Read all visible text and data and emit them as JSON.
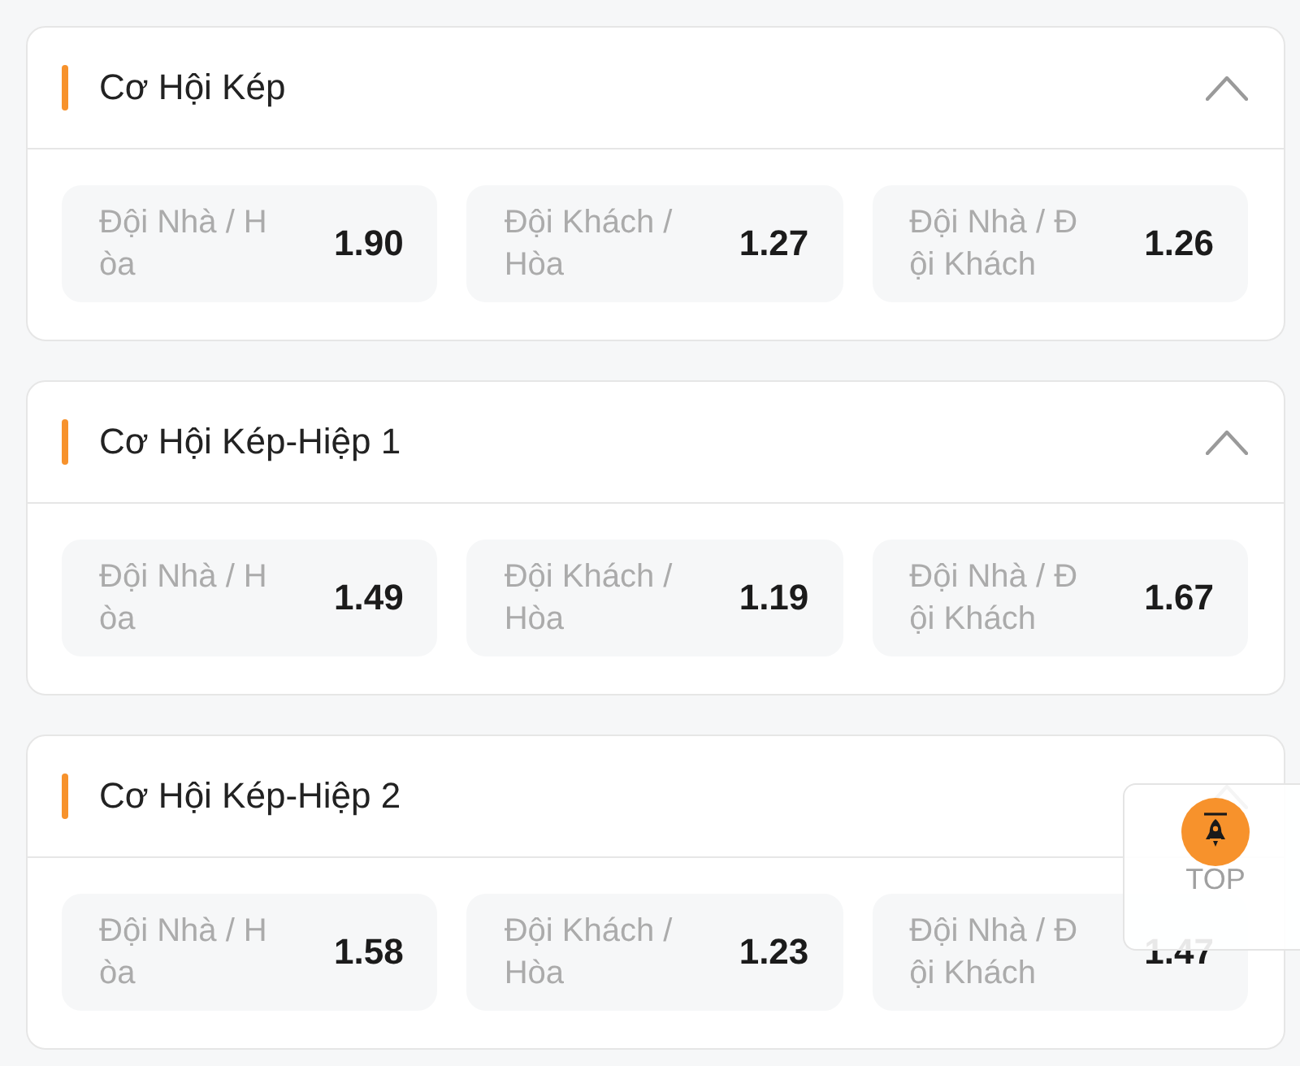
{
  "sections": [
    {
      "title": "Cơ Hội Kép",
      "expanded": true,
      "options": [
        {
          "label": "Đội Nhà / Hòa",
          "odds": "1.90"
        },
        {
          "label": "Đội Khách / Hòa",
          "odds": "1.27"
        },
        {
          "label": "Đội Nhà / Đội Khách",
          "odds": "1.26"
        }
      ]
    },
    {
      "title": "Cơ Hội Kép-Hiệp 1",
      "expanded": true,
      "options": [
        {
          "label": "Đội Nhà / Hòa",
          "odds": "1.49"
        },
        {
          "label": "Đội Khách / Hòa",
          "odds": "1.19"
        },
        {
          "label": "Đội Nhà / Đội Khách",
          "odds": "1.67"
        }
      ]
    },
    {
      "title": "Cơ Hội Kép-Hiệp 2",
      "expanded": true,
      "options": [
        {
          "label": "Đội Nhà / Hòa",
          "odds": "1.58"
        },
        {
          "label": "Đội Khách / Hòa",
          "odds": "1.23"
        },
        {
          "label": "Đội Nhà / Đội Khách",
          "odds": "1.47"
        }
      ]
    }
  ],
  "back_to_top": {
    "label": "TOP"
  }
}
